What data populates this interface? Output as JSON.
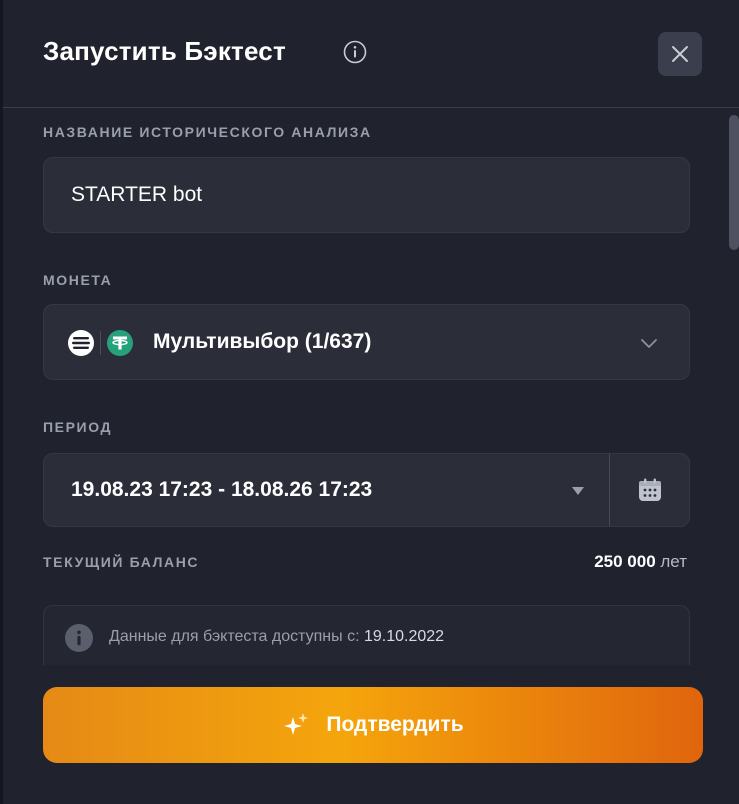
{
  "header": {
    "title": "Запустить Бэктест"
  },
  "name_section": {
    "label": "НАЗВАНИЕ ИСТОРИЧЕСКОГО АНАЛИЗА",
    "value": "STARTER bot"
  },
  "coin_section": {
    "label": "МОНЕТА",
    "value": "Мультивыбор (1/637)"
  },
  "period_section": {
    "label": "ПЕРИОД",
    "value": "19.08.23 17:23 - 18.08.26 17:23"
  },
  "balance": {
    "label": "ТЕКУЩИЙ БАЛАНС",
    "amount": "250 000",
    "unit": "лет"
  },
  "notice": {
    "text": "Данные для бэктеста доступны с:",
    "date": "19.10.2022"
  },
  "confirm_button": {
    "label": "Подтвердить"
  },
  "colors": {
    "background": "#20232d",
    "field": "#2b2e39",
    "accent_start": "#e58a16",
    "accent_end": "#e0650d",
    "muted_text": "#9a9fae",
    "tether_green": "#26a17b"
  }
}
